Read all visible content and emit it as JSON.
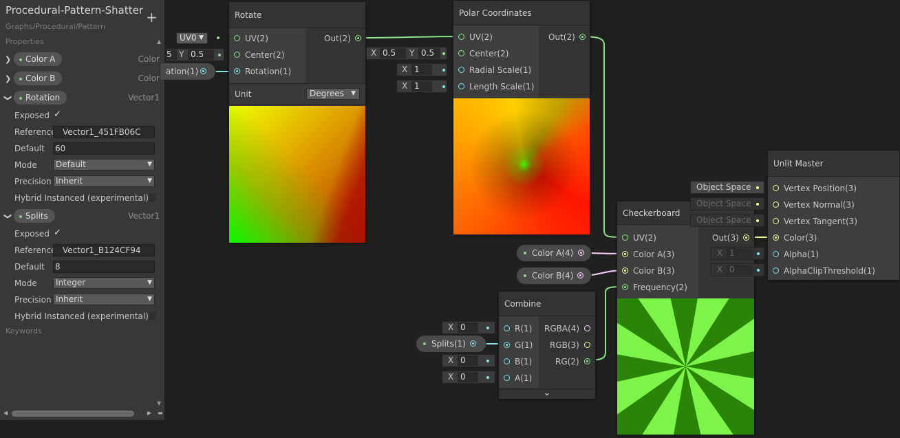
{
  "blackboard": {
    "title": "Procedural-Pattern-Shatter",
    "subtitle": "Graphs/Procedural/Pattern",
    "add_label": "+",
    "properties_label": "Properties",
    "keywords_label": "Keywords",
    "color_a": {
      "name": "Color A",
      "type": "Color"
    },
    "color_b": {
      "name": "Color B",
      "type": "Color"
    },
    "rotation": {
      "name": "Rotation",
      "type": "Vector1",
      "exposed_label": "Exposed",
      "exposed_check": "✓",
      "reference_label": "Reference",
      "reference": "Vector1_451FB06C",
      "default_label": "Default",
      "default": "60",
      "mode_label": "Mode",
      "mode": "Default",
      "precision_label": "Precision",
      "precision": "Inherit",
      "hybrid_label": "Hybrid Instanced (experimental)"
    },
    "splits": {
      "name": "Splits",
      "type": "Vector1",
      "exposed_label": "Exposed",
      "exposed_check": "✓",
      "reference_label": "Reference",
      "reference": "Vector1_B124CF94",
      "default_label": "Default",
      "default": "8",
      "mode_label": "Mode",
      "mode": "Integer",
      "precision_label": "Precision",
      "precision": "Inherit",
      "hybrid_label": "Hybrid Instanced (experimental)"
    }
  },
  "rotate": {
    "title": "Rotate",
    "in_uv": "UV(2)",
    "in_center": "Center(2)",
    "in_rotation": "Rotation(1)",
    "out": "Out(2)",
    "unit_label": "Unit",
    "unit_value": "Degrees",
    "uv_dropdown": "UV0",
    "center_x": "5",
    "center_y_label": "Y",
    "center_y": "0.5",
    "rotation_chip": "ation(1)"
  },
  "polar": {
    "title": "Polar Coordinates",
    "in_uv": "UV(2)",
    "in_center": "Center(2)",
    "in_radial": "Radial Scale(1)",
    "in_length": "Length Scale(1)",
    "out": "Out(2)",
    "center_x_label": "X",
    "center_x": "0.5",
    "center_y_label": "Y",
    "center_y": "0.5",
    "radial_x_label": "X",
    "radial_x": "1",
    "length_x_label": "X",
    "length_x": "1"
  },
  "checkerboard": {
    "title": "Checkerboard",
    "in_uv": "UV(2)",
    "in_color_a": "Color A(3)",
    "in_color_b": "Color B(3)",
    "in_frequency": "Frequency(2)",
    "out": "Out(3)",
    "color_a_prop": "Color A(4)",
    "color_b_prop": "Color B(4)"
  },
  "combine": {
    "title": "Combine",
    "in_r": "R(1)",
    "in_g": "G(1)",
    "in_b": "B(1)",
    "in_a": "A(1)",
    "out_rgba": "RGBA(4)",
    "out_rgb": "RGB(3)",
    "out_rg": "RG(2)",
    "r_x_label": "X",
    "r_x": "0",
    "b_x_label": "X",
    "b_x": "0",
    "a_x_label": "X",
    "a_x": "0",
    "splits_prop": "Splits(1)",
    "expand": "⌄"
  },
  "master": {
    "title": "Unlit Master",
    "in_vpos": "Vertex Position(3)",
    "in_vnorm": "Vertex Normal(3)",
    "in_vtan": "Vertex Tangent(3)",
    "in_color": "Color(3)",
    "in_alpha": "Alpha(1)",
    "in_clip": "AlphaClipThreshold(1)",
    "space_pos": "Object Space",
    "space_norm": "Object Space",
    "space_tan": "Object Space",
    "alpha_x_label": "X",
    "alpha_x": "1",
    "clip_x_label": "X",
    "clip_x": "0"
  },
  "colors": {
    "wire_green": "#8ee58b",
    "wire_cyan": "#84e4e7",
    "wire_yellow": "#f6ff9a",
    "wire_pink": "#fcd2ff",
    "checker_light": "#7cf44a",
    "checker_dark": "#2a8407"
  },
  "checker_splits": 8
}
